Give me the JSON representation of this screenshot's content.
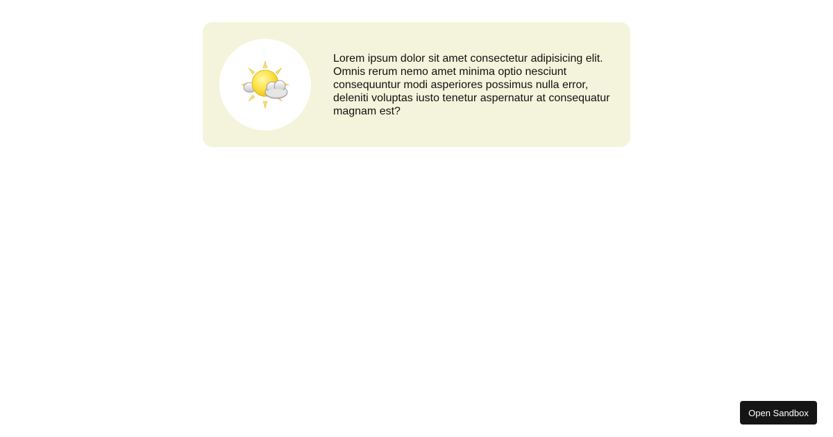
{
  "card": {
    "icon": "partly-cloudy-weather-icon",
    "text": "Lorem ipsum dolor sit amet consectetur adipisicing elit. Omnis rerum nemo amet minima optio nesciunt consequuntur modi asperiores possimus nulla error, deleniti voluptas iusto tenetur aspernatur at consequatur magnam est?",
    "background": "#f4f4dc"
  },
  "sandbox_button": {
    "label": "Open Sandbox",
    "background": "#151515"
  }
}
